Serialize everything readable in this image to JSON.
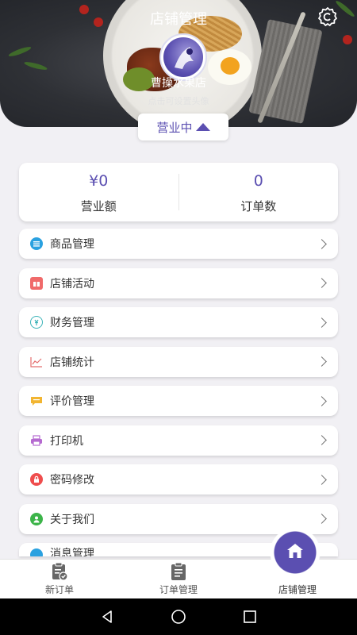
{
  "header": {
    "title": "店铺管理",
    "store_name": "曹操水果店",
    "avatar_hint": "点击可设置头像",
    "status_label": "营业中"
  },
  "stats": [
    {
      "value": "¥0",
      "label": "营业额"
    },
    {
      "value": "0",
      "label": "订单数"
    }
  ],
  "menu": [
    {
      "label": "商品管理",
      "icon": "list-icon",
      "color": "#2aa1e0"
    },
    {
      "label": "店铺活动",
      "icon": "gift-icon",
      "color": "#f06a6a"
    },
    {
      "label": "财务管理",
      "icon": "finance-icon",
      "color": "#3bb3b8"
    },
    {
      "label": "店铺统计",
      "icon": "chart-icon",
      "color": "#e46d6d"
    },
    {
      "label": "评价管理",
      "icon": "comment-icon",
      "color": "#f2b531"
    },
    {
      "label": "打印机",
      "icon": "printer-icon",
      "color": "#b56ad0"
    },
    {
      "label": "密码修改",
      "icon": "lock-icon",
      "color": "#ef4d4d"
    },
    {
      "label": "关于我们",
      "icon": "user-icon",
      "color": "#3cb449"
    },
    {
      "label": "消息管理",
      "icon": "message-icon",
      "color": "#2aa1e0"
    }
  ],
  "tabs": [
    {
      "label": "新订单",
      "icon": "new-order-icon"
    },
    {
      "label": "订单管理",
      "icon": "order-list-icon"
    },
    {
      "label": "店铺管理",
      "icon": "store-icon"
    }
  ],
  "colors": {
    "accent": "#5b4fb1",
    "background": "#f1f0f4"
  }
}
